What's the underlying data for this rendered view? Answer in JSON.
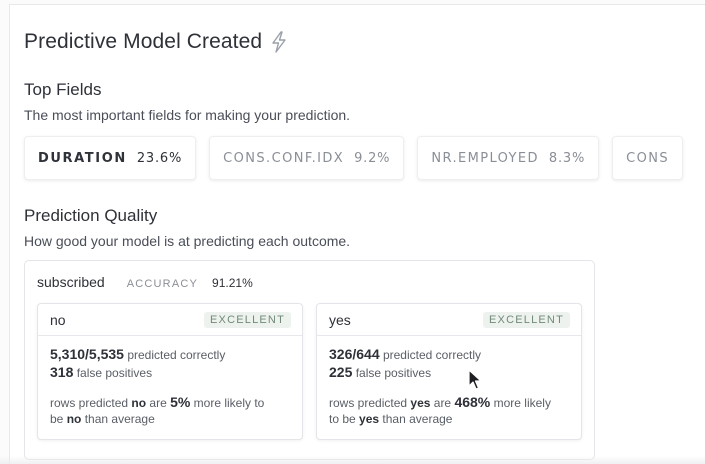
{
  "header": {
    "title": "Predictive Model Created",
    "icon": "lightning-bolt-icon"
  },
  "top_fields": {
    "heading": "Top Fields",
    "description": "The most important fields for making your prediction.",
    "fields": [
      {
        "name": "DURATION",
        "pct": "23.6%"
      },
      {
        "name": "CONS.CONF.IDX",
        "pct": "9.2%"
      },
      {
        "name": "NR.EMPLOYED",
        "pct": "8.3%"
      },
      {
        "name": "CONS",
        "pct": ""
      }
    ]
  },
  "quality": {
    "heading": "Prediction Quality",
    "description": "How good your model is at predicting each outcome.",
    "target": "subscribed",
    "accuracy_label": "ACCURACY",
    "accuracy_value": "91.21%",
    "outcomes": [
      {
        "label": "no",
        "badge": "EXCELLENT",
        "correct": "5,310/5,535",
        "correct_text": "predicted correctly",
        "false_pos": "318",
        "false_pos_text": "false positives",
        "rel_prefix": "rows predicted",
        "rel_value": "no",
        "rel_are": "are",
        "rel_pct": "5%",
        "rel_more": "more likely to",
        "rel_be": "be",
        "rel_value2": "no",
        "rel_suffix": "than average"
      },
      {
        "label": "yes",
        "badge": "EXCELLENT",
        "correct": "326/644",
        "correct_text": "predicted correctly",
        "false_pos": "225",
        "false_pos_text": "false positives",
        "rel_prefix": "rows predicted",
        "rel_value": "yes",
        "rel_are": "are",
        "rel_pct": "468%",
        "rel_more": "more likely",
        "rel_be": "to be",
        "rel_value2": "yes",
        "rel_suffix": "than average"
      }
    ]
  },
  "colors": {
    "badge_text": "#6f8a78",
    "badge_bg": "#eef2ef",
    "muted": "#8a8e96"
  }
}
